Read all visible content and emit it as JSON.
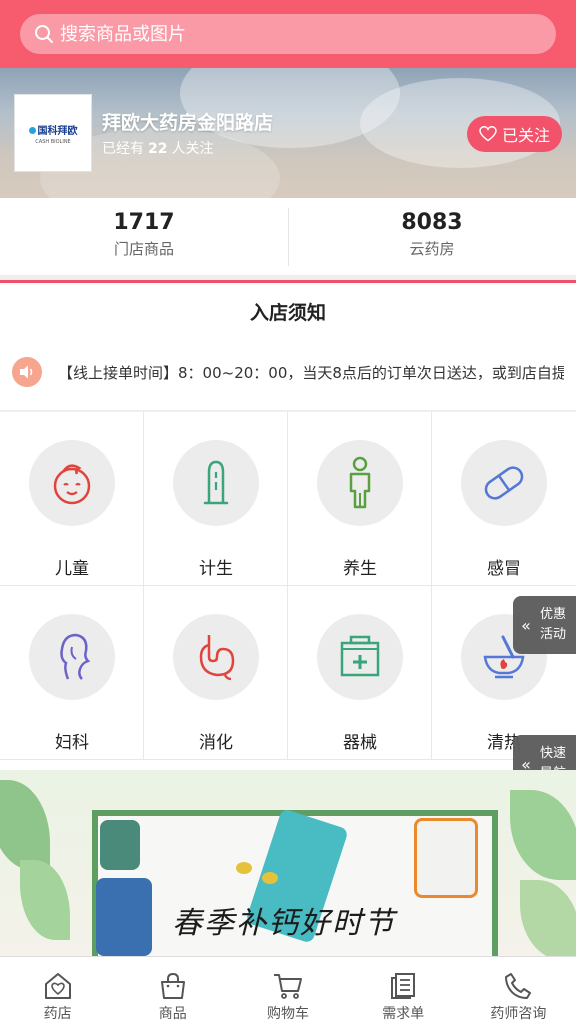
{
  "search": {
    "placeholder": "搜索商品或图片"
  },
  "store": {
    "logo_brand": "国科拜欧",
    "logo_sub": "CASH BIOLINE",
    "name": "拜欧大药房金阳路店",
    "follow_prefix": "已经有",
    "follow_count": "22",
    "follow_suffix": "人关注",
    "follow_button": "已关注"
  },
  "stats": [
    {
      "value": "1717",
      "label": "门店商品"
    },
    {
      "value": "8083",
      "label": "云药房"
    }
  ],
  "notice": {
    "title": "入店须知",
    "text": "【线上接单时间】8：00~20：00，当天8点后的订单次日送达，或到店自提"
  },
  "categories": [
    {
      "label": "儿童",
      "icon": "child-face-icon"
    },
    {
      "label": "计生",
      "icon": "condom-icon"
    },
    {
      "label": "养生",
      "icon": "person-icon"
    },
    {
      "label": "感冒",
      "icon": "capsule-icon"
    },
    {
      "label": "妇科",
      "icon": "woman-profile-icon"
    },
    {
      "label": "消化",
      "icon": "stomach-icon"
    },
    {
      "label": "器械",
      "icon": "medical-kit-icon"
    },
    {
      "label": "清热",
      "icon": "mortar-icon"
    }
  ],
  "side_tabs": [
    {
      "line1": "优惠",
      "line2": "活动"
    },
    {
      "line1": "快速",
      "line2": "导航"
    }
  ],
  "banner": {
    "slogan": "春季补钙好时节"
  },
  "tabbar": [
    {
      "label": "药店",
      "icon": "store-icon"
    },
    {
      "label": "商品",
      "icon": "bag-icon"
    },
    {
      "label": "购物车",
      "icon": "cart-icon"
    },
    {
      "label": "需求单",
      "icon": "list-icon"
    },
    {
      "label": "药师咨询",
      "icon": "phone-icon"
    }
  ],
  "colors": {
    "brand_red": "#f75b6e",
    "follow_button": "#f2526a",
    "icon_red": "#e0443c",
    "icon_green": "#3aa57a",
    "icon_blue": "#5577d6"
  }
}
